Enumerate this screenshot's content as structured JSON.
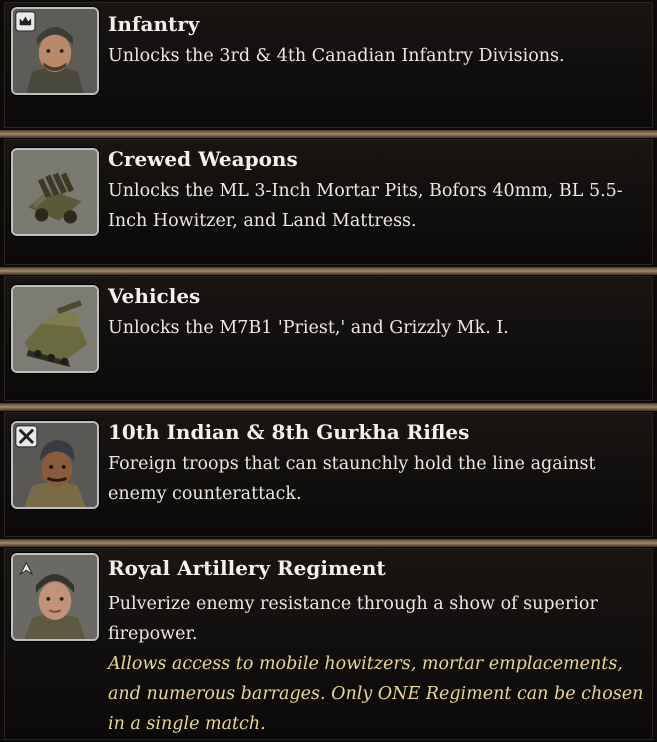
{
  "entries": [
    {
      "icon": "infantry-soldier-portrait-icon",
      "title": "Infantry",
      "description": "Unlocks the 3rd & 4th Canadian Infantry Divisions."
    },
    {
      "icon": "crewed-weapons-mortar-icon",
      "title": "Crewed Weapons",
      "description": "Unlocks the ML 3-Inch Mortar Pits, Bofors 40mm, BL 5.5-Inch Howitzer, and Land Mattress."
    },
    {
      "icon": "vehicles-priest-icon",
      "title": "Vehicles",
      "description": "Unlocks the M7B1 'Priest,' and Grizzly Mk. I."
    },
    {
      "icon": "gurkha-rifleman-portrait-icon",
      "title": "10th Indian & 8th Gurkha Rifles",
      "description": "Foreign troops that can staunchly hold the line against enemy counterattack."
    },
    {
      "icon": "artillery-officer-portrait-icon",
      "title": "Royal Artillery Regiment",
      "description": "Pulverize enemy resistance through a show of superior firepower.",
      "note": "Allows access to mobile howitzers, mortar emplacements, and numerous barrages. Only ONE Regiment can be chosen in a single match."
    }
  ]
}
